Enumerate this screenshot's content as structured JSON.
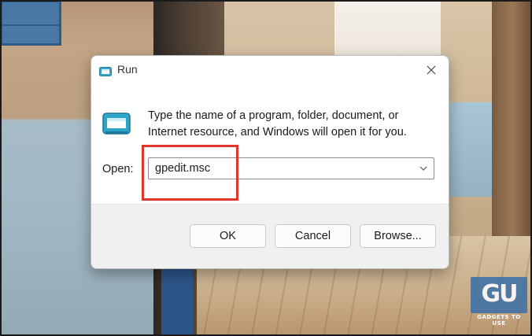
{
  "dialog": {
    "title": "Run",
    "close_icon": "close-icon",
    "app_icon": "run-icon",
    "description": "Type the name of a program, folder, document, or Internet resource, and Windows will open it for you.",
    "open_label": "Open:",
    "open_value": "gpedit.msc",
    "dropdown_icon": "chevron-down-icon",
    "buttons": {
      "ok": "OK",
      "cancel": "Cancel",
      "browse": "Browse..."
    }
  },
  "watermark": {
    "logo_text": "GU",
    "caption": "GADGETS TO USE"
  },
  "colors": {
    "highlight": "#e0362c",
    "dialog_bg": "#ffffff",
    "footer_bg": "#f0f0f0"
  }
}
